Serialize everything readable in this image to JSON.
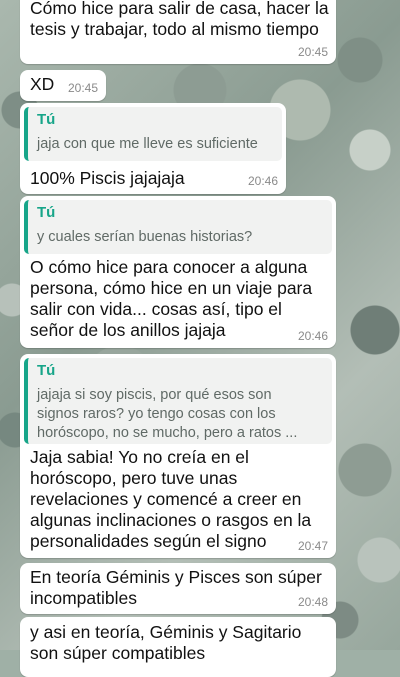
{
  "messages": [
    {
      "text": "Cómo hice para salir de casa, hacer la\ntesis y trabajar, todo al mismo tiempo",
      "time": "20:45"
    },
    {
      "text": "XD",
      "time": "20:45"
    },
    {
      "quote_author": "Tú",
      "quote_text": "jaja con que me lleve es suficiente",
      "text": "100% Piscis jajajaja",
      "time": "20:46"
    },
    {
      "quote_author": "Tú",
      "quote_text": "y cuales serían buenas historias?",
      "text": "O cómo hice para conocer a alguna\npersona, cómo hice en un viaje para\nsalir con vida... cosas así, tipo el\nseñor de los anillos jajaja",
      "time": "20:46"
    },
    {
      "quote_author": "Tú",
      "quote_text": "jajaja si soy piscis, por qué esos son\nsignos raros? yo tengo cosas con los\nhoróscopo, no se mucho, pero a ratos ...",
      "text": "Jaja sabia! Yo no creía en el\nhoróscopo, pero tuve unas\nrevelaciones y comencé a creer en\nalgunas inclinaciones o rasgos en la\npersonalidades según el signo",
      "time": "20:47"
    },
    {
      "text": "En teoría Géminis y Pisces son súper\nincompatibles",
      "time": "20:48"
    },
    {
      "text": "y asi en teoría, Géminis y Sagitario\nson súper compatibles",
      "time": ""
    }
  ]
}
